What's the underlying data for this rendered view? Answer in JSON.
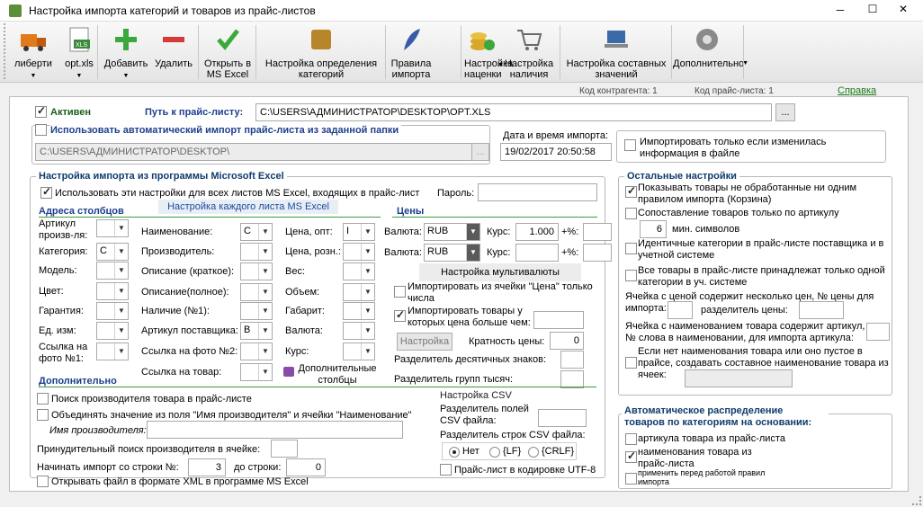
{
  "window": {
    "title": "Настройка импорта категорий и товаров из прайс-листов",
    "min": "─",
    "max": "☐",
    "close": "✕"
  },
  "toolbar": [
    {
      "id": "delivery",
      "label": "либерти",
      "icon": "truck-icon",
      "arrow": "▼"
    },
    {
      "id": "optxls",
      "label": "opt.xls",
      "icon": "xls-file-icon",
      "arrow": "▼"
    },
    {
      "id": "add",
      "label": "Добавить",
      "icon": "plus-icon",
      "arrow": "▼"
    },
    {
      "id": "del",
      "label": "Удалить",
      "icon": "minus-icon",
      "arrow": ""
    },
    {
      "id": "openxls",
      "label": "Открыть в MS Excel",
      "icon": "checkmark-icon",
      "arrow": ""
    },
    {
      "id": "catdef",
      "label": "Настройка определения категорий",
      "icon": "category-icon",
      "arrow": ""
    },
    {
      "id": "rules",
      "label": "Правила импорта",
      "icon": "feather-icon",
      "arrow": ""
    },
    {
      "id": "markup",
      "label": "Настройка наценки",
      "icon": "coins-icon",
      "arrow": "▼"
    },
    {
      "id": "stock",
      "label": "Настройка наличия",
      "icon": "cart-icon",
      "arrow": ""
    },
    {
      "id": "composite",
      "label": "Настройка составных значений",
      "icon": "laptop-icon",
      "arrow": ""
    },
    {
      "id": "more",
      "label": "Дополнительно",
      "icon": "gear-icon",
      "arrow": "▼"
    }
  ],
  "status": {
    "contractor": "Код контрагента: 1",
    "pricelist": "Код прайс-листа: 1",
    "help": "Справка"
  },
  "top": {
    "active": "Активен",
    "path_label": "Путь к прайс-листу:",
    "path": "C:\\USERS\\АДМИНИСТРАТОР\\DESKTOP\\OPT.XLS",
    "browse": "...",
    "auto": "Использовать автоматический импорт прайс-листа из заданной папки",
    "folder": "C:\\USERS\\АДМИНИСТРАТОР\\DESKTOP\\",
    "date_label": "Дата и время импорта:",
    "date": "19/02/2017 20:50:58",
    "only_changed": "Импортировать только если изменилась информация в файле"
  },
  "excel": {
    "title": "Настройка импорта из программы Microsoft Excel",
    "use_all": "Использовать эти настройки для всех листов MS Excel, входящих в прайс-лист",
    "password": "Пароль:",
    "addr": "Адреса столбцов",
    "each_sheet": "Настройка каждого листа MS Excel",
    "prices": "Цены",
    "col1": [
      {
        "label": "Артикул произв-ля:",
        "val": ""
      },
      {
        "label": "Категория:",
        "val": "C"
      },
      {
        "label": "Модель:",
        "val": ""
      },
      {
        "label": "Цвет:",
        "val": ""
      },
      {
        "label": "Гарантия:",
        "val": ""
      },
      {
        "label": "Ед. изм:",
        "val": ""
      },
      {
        "label": "Ссылка на фото №1:",
        "val": ""
      }
    ],
    "col2": [
      {
        "label": "Наименование:",
        "val": "C"
      },
      {
        "label": "Производитель:",
        "val": ""
      },
      {
        "label": "Описание (краткое):",
        "val": ""
      },
      {
        "label": "Описание(полное):",
        "val": ""
      },
      {
        "label": "Наличие (№1):",
        "val": ""
      },
      {
        "label": "Артикул поставщика:",
        "val": "B"
      },
      {
        "label": "Ссылка на фото №2:",
        "val": ""
      },
      {
        "label": "Ссылка на товар:",
        "val": ""
      }
    ],
    "col3": [
      {
        "label": "Цена, опт:",
        "val": "I"
      },
      {
        "label": "Цена, розн.:",
        "val": ""
      },
      {
        "label": "Вес:",
        "val": ""
      },
      {
        "label": "Объем:",
        "val": ""
      },
      {
        "label": "Габарит:",
        "val": ""
      },
      {
        "label": "Валюта:",
        "val": ""
      },
      {
        "label": "Курс:",
        "val": ""
      }
    ],
    "extra_cols": "Дополнительные столбцы",
    "currency_label": "Валюта:",
    "rate_label": "Курс:",
    "pct": "+%:",
    "cur1": "RUB",
    "rate1": "1.000",
    "cur2": "RUB",
    "rate2": "",
    "multicur": "Настройка мультивалюты",
    "import_from_price": "Импортировать из ячейки \"Цена\" только числа",
    "import_higher": "Импортировать товары у которых цена больше чем:",
    "setup": "Настройка",
    "mult": "Кратность цены:",
    "mult_val": "0",
    "dec_sep": "Разделитель десятичных знаков:",
    "thou_sep": "Разделитель групп тысяч:"
  },
  "extra": {
    "title": "Дополнительно",
    "find_mfr": "Поиск производителя товара в прайс-листе",
    "merge": "Объединять значение из поля \"Имя производителя\" и ячейки \"Наименование\"",
    "mfr_name": "Имя производителя:",
    "force": "Принудительный поиск производителя в ячейке:",
    "start_row": "Начинать импорт со строки №:",
    "start_val": "3",
    "to_row": "до строки:",
    "to_val": "0",
    "xml": "Открывать файл в формате XML в программе MS Excel"
  },
  "csv": {
    "title": "Настройка CSV",
    "field_sep": "Разделитель полей CSV файла:",
    "row_sep": "Разделитель строк CSV файла:",
    "opts": [
      "Нет",
      "{LF}",
      "{CRLF}"
    ],
    "utf8": "Прайс-лист в кодировке UTF-8"
  },
  "other": {
    "title": "Остальные настройки",
    "show_unproc": "Показывать товары не обработанные ни одним правилом импорта (Корзина)",
    "by_article": "Сопоставление товаров только по артикулу",
    "min_val": "6",
    "min_sym": "мин. символов",
    "ident": "Идентичные категории в прайс-листе поставщика и в учетной системе",
    "one_cat": "Все товары в прайс-листе принадлежат только одной категории в уч. системе",
    "multi_price": "Ячейка с ценой содержит несколько цен, № цены для импорта:",
    "price_sep": "разделитель цены:",
    "name_art": "Ячейка с наименованием товара содержит артикул, № слова в наименовании, для импорта артикула:",
    "composite": "Если нет наименования товара или оно пустое в прайсе, создавать составное наименование товара из ячеек:"
  },
  "auto": {
    "title": "Автоматическое распределение товаров по категориям на основании:",
    "by_article": "артикула товара из прайс-листа",
    "by_name": "наименования товара из прайс-листа",
    "apply": "применить перед работой правил импорта"
  }
}
